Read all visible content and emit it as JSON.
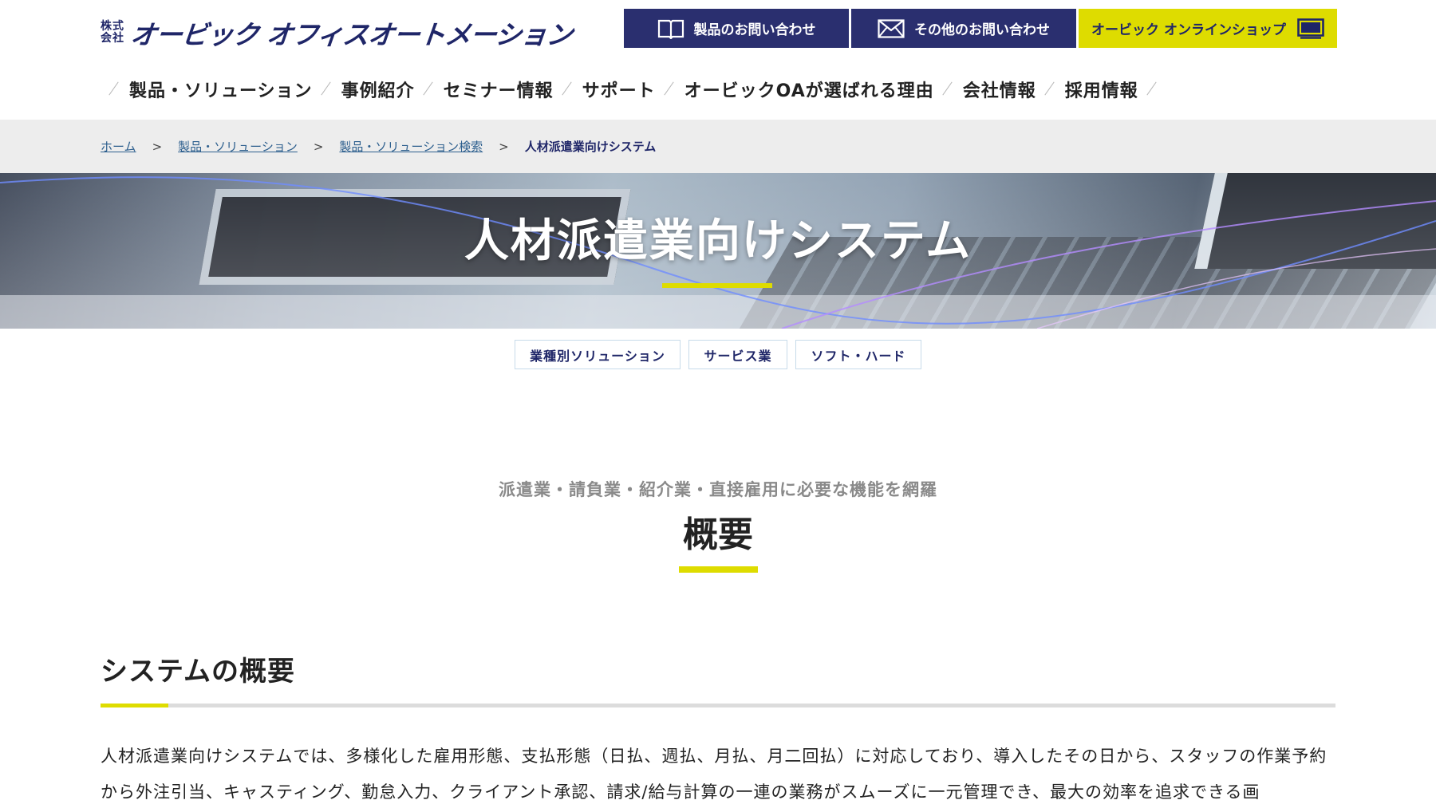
{
  "header": {
    "logo_prefix": "株式会社",
    "logo_name": "オービック オフィスオートメーション",
    "buttons": {
      "product_inquiry": "製品のお問い合わせ",
      "other_inquiry": "その他のお問い合わせ",
      "online_shop": "オービック オンラインショップ"
    },
    "nav": [
      "製品・ソリューション",
      "事例紹介",
      "セミナー情報",
      "サポート",
      "オービックOAが選ばれる理由",
      "会社情報",
      "採用情報"
    ]
  },
  "breadcrumb": {
    "home": "ホーム",
    "products": "製品・ソリューション",
    "search": "製品・ソリューション検索",
    "current": "人材派遣業向けシステム",
    "separator": ">"
  },
  "hero": {
    "title": "人材派遣業向けシステム"
  },
  "tags": [
    "業種別ソリューション",
    "サービス業",
    "ソフト・ハード"
  ],
  "overview": {
    "catch": "派遣業・請負業・紹介業・直接雇用に必要な機能を網羅",
    "title": "概要"
  },
  "section": {
    "title": "システムの概要",
    "body": "人材派遣業向けシステムでは、多様化した雇用形態、支払形態（日払、週払、月払、月二回払）に対応しており、導入したその日から、スタッフの作業予約から外注引当、キャスティング、勤怠入力、クライアント承認、請求/給与計算の一連の業務がスムーズに一元管理でき、最大の効率を追求できる画"
  },
  "colors": {
    "navy": "#2a2f6f",
    "accent": "#dedc00",
    "link": "#2d5f8e"
  },
  "icons": {
    "book": "book-icon",
    "mail": "mail-icon",
    "monitor": "monitor-icon"
  }
}
